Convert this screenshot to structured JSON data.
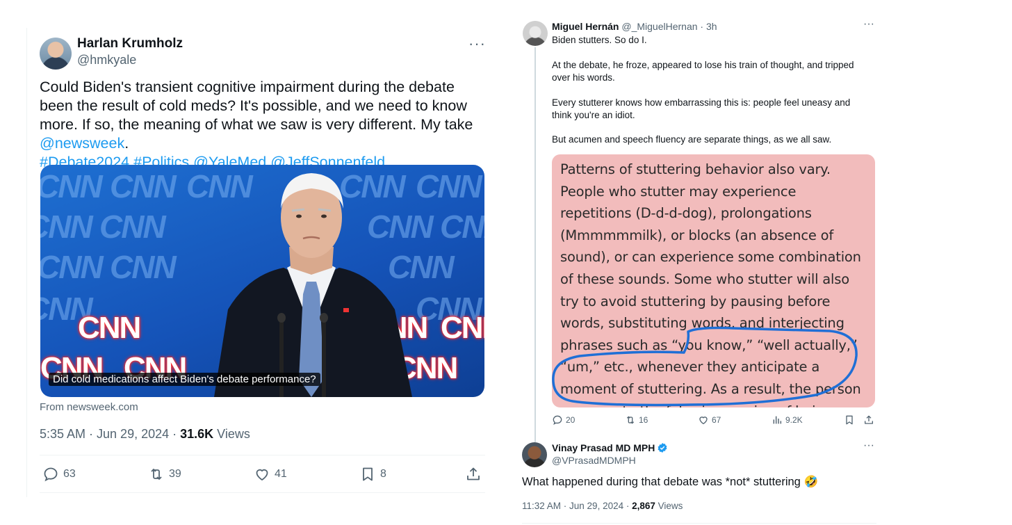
{
  "left_tweet": {
    "author_name": "Harlan Krumholz",
    "author_handle": "@hmkyale",
    "text_plain": "Could Biden's transient cognitive impairment during the debate been the result of cold meds? It's possible, and we need to know more. If so, the meaning of what we saw is very different. My take ",
    "mention_newsweek": "@newsweek",
    "period": ".",
    "hashtag_debate": "#Debate2024",
    "hashtag_politics": "#Politics",
    "mention_yalemed": "@YaleMed",
    "mention_sonnenfeld": "@JeffSonnenfeld",
    "image_caption": "Did cold medications affect Biden's debate performance?",
    "image_logo_text": "CNN",
    "source": "From newsweek.com",
    "time_date": "5:35 AM · Jun 29, 2024 · ",
    "views_count": "31.6K",
    "views_label": " Views",
    "replies": "63",
    "retweets": "39",
    "likes": "41",
    "bookmarks": "8"
  },
  "right_tweet_1": {
    "author_name": "Miguel Hernán",
    "author_handle": "@_MiguelHernan",
    "time": "· 3h",
    "para1": "Biden stutters. So do I.",
    "para2": "At the debate, he froze, appeared to lose his train of thought, and tripped over his words.",
    "para3": "Every stutterer knows how embarrassing this is: people feel uneasy and think you're an idiot.",
    "para4": "But acumen and speech fluency are separate things, as we all saw.",
    "image_text": "Patterns of stuttering behavior also vary. People who stutter may experience repetitions (D-d-d-dog), prolongations (Mmmmmmilk), or blocks (an absence of sound), or can experience some combination of these sounds.  Some who stutter will also try to avoid stuttering by pausing before words, substituting words, and interjecting phrases such as “you know,” “well actually,” “um,” etc., whenever they anticipate a moment of stuttering. As a result, the person may create the false impression of being hesitant, uncertain, or confused.",
    "replies": "20",
    "retweets": "16",
    "likes": "67",
    "views": "9.2K"
  },
  "right_tweet_2": {
    "author_name": "Vinay Prasad MD MPH",
    "author_handle": "@VPrasadMDMPH",
    "text": "What happened during that debate was *not* stuttering 🤣",
    "time_date": "11:32 AM · Jun 29, 2024 · ",
    "views_count": "2,867",
    "views_label": " Views"
  },
  "colors": {
    "link": "#1d9bf0",
    "secondary_text": "#536471",
    "verified": "#1d9bf0",
    "quote_bg": "#f2bcbc",
    "annotation_circle": "#1f6fd6"
  },
  "icons": [
    "more-icon",
    "reply-icon",
    "retweet-icon",
    "like-icon",
    "bookmark-icon",
    "share-icon",
    "views-icon",
    "verified-badge-icon"
  ]
}
